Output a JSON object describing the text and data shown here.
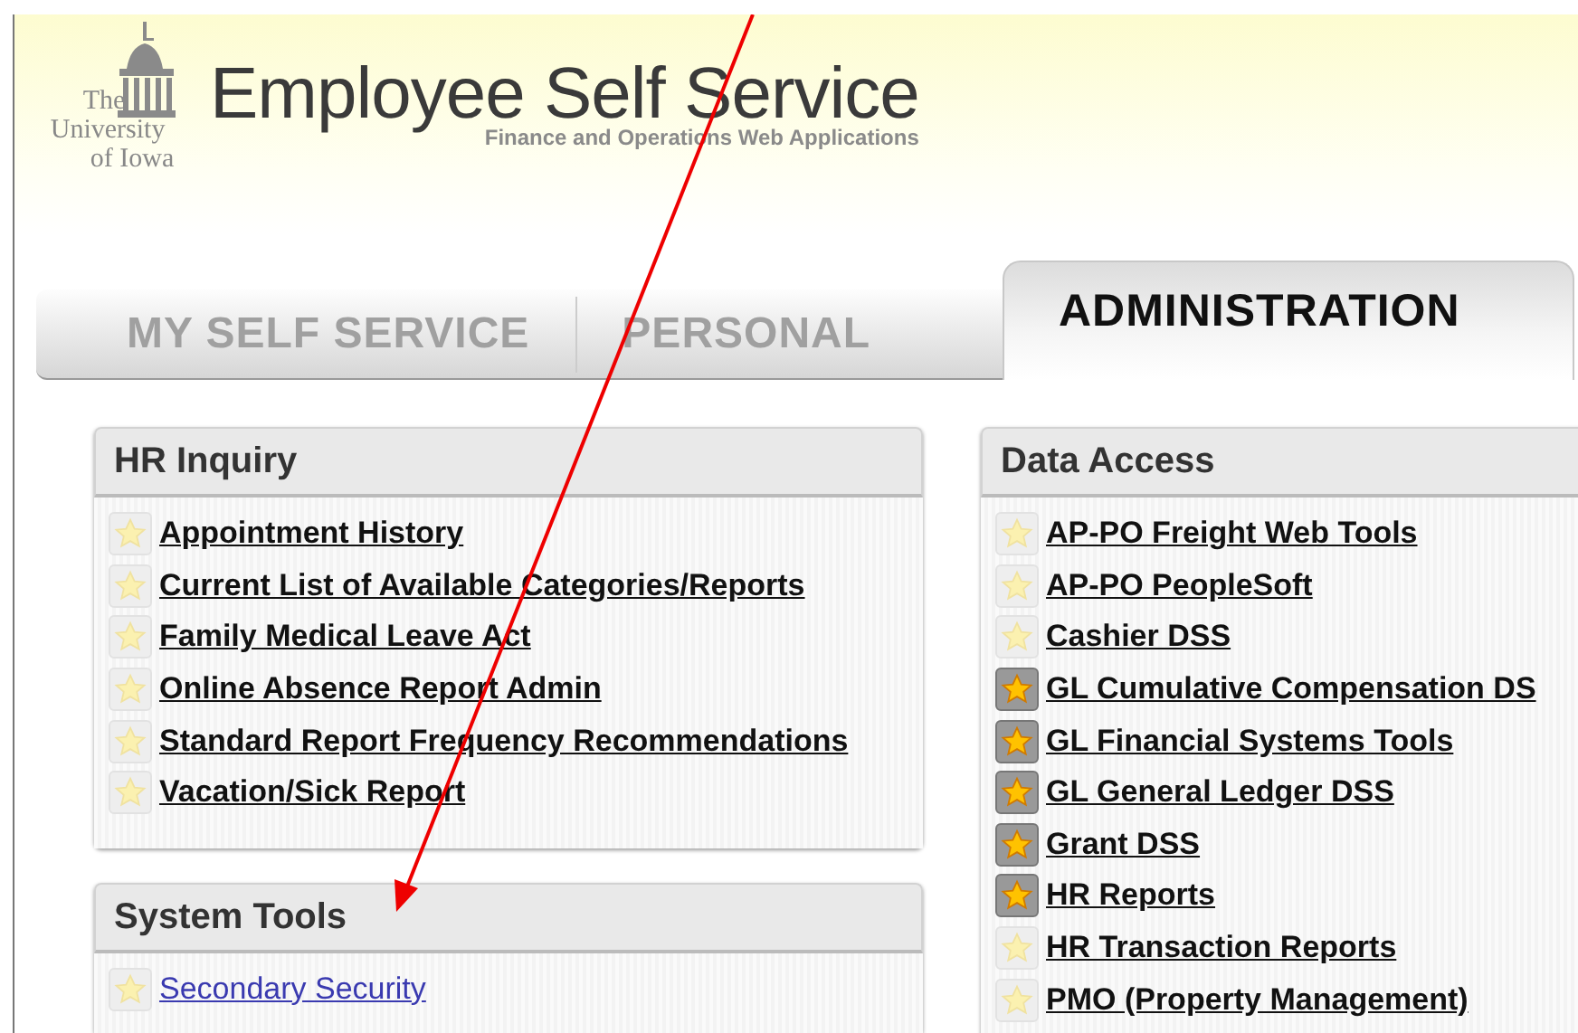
{
  "header": {
    "logo_lines": [
      "The",
      "University",
      "of Iowa"
    ],
    "title": "Employee Self Service",
    "subtitle": "Finance and Operations Web Applications"
  },
  "tabs": [
    {
      "label": "MY SELF SERVICE",
      "selected": false
    },
    {
      "label": "PERSONAL",
      "selected": false
    },
    {
      "label": "ADMINISTRATION",
      "selected": true
    }
  ],
  "columns": [
    [
      {
        "title": "HR Inquiry",
        "links": [
          {
            "label": "Appointment History",
            "favorite": false,
            "visited": true
          },
          {
            "label": "Current List of Available Categories/Reports",
            "favorite": false,
            "visited": true
          },
          {
            "label": "Family Medical Leave Act",
            "favorite": false,
            "visited": true
          },
          {
            "label": "Online Absence Report Admin",
            "favorite": false,
            "visited": true
          },
          {
            "label": "Standard Report Frequency Recommendations",
            "favorite": false,
            "visited": true
          },
          {
            "label": "Vacation/Sick Report",
            "favorite": false,
            "visited": true
          }
        ]
      },
      {
        "title": "System Tools",
        "links": [
          {
            "label": "Secondary Security",
            "favorite": false,
            "visited": false
          }
        ]
      }
    ],
    [
      {
        "title": "Data Access",
        "links": [
          {
            "label": "AP-PO Freight Web Tools",
            "favorite": false,
            "visited": true
          },
          {
            "label": "AP-PO PeopleSoft",
            "favorite": false,
            "visited": true
          },
          {
            "label": "Cashier DSS",
            "favorite": false,
            "visited": true
          },
          {
            "label": "GL Cumulative Compensation DS",
            "favorite": true,
            "visited": true
          },
          {
            "label": "GL Financial Systems Tools",
            "favorite": true,
            "visited": true
          },
          {
            "label": "GL General Ledger DSS",
            "favorite": true,
            "visited": true
          },
          {
            "label": "Grant DSS",
            "favorite": true,
            "visited": true
          },
          {
            "label": "HR Reports",
            "favorite": true,
            "visited": true
          },
          {
            "label": "HR Transaction Reports",
            "favorite": false,
            "visited": true
          },
          {
            "label": "PMO (Property Management)",
            "favorite": false,
            "visited": true
          }
        ]
      }
    ]
  ],
  "annotation": {
    "kind": "arrow"
  }
}
